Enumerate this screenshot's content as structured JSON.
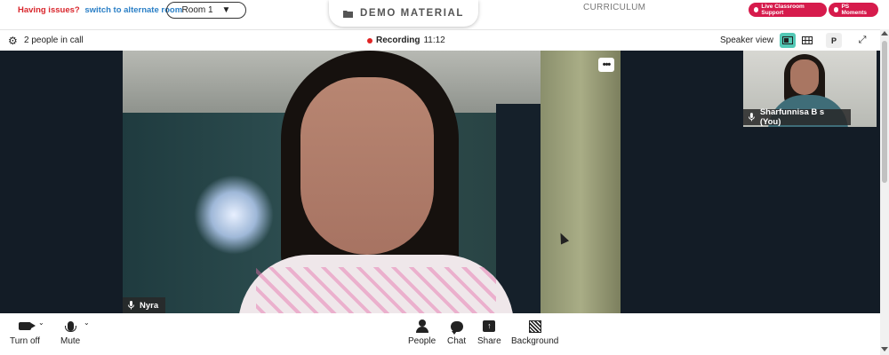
{
  "header": {
    "issue_text": "Having issues?",
    "alternate_link": "switch to alternate room",
    "room_select": {
      "value": "Room 1"
    },
    "demo_tab": "DEMO MATERIAL",
    "curriculum": "CURRICULUM",
    "live_support": "Live Classroom Support",
    "ps_moments": "PS Moments",
    "accent_color": "#d61b4c"
  },
  "call_bar": {
    "people_count": "2 people in call",
    "recording_label": "Recording",
    "recording_time": "11:12",
    "view_label": "Speaker view",
    "pin_label": "P",
    "active_view_color": "#53c8b5"
  },
  "stage": {
    "main_participant": "Nyra",
    "self_participant": "Sharfunnisa B s (You)",
    "more_label": "•••"
  },
  "toolbar": {
    "camera_label": "Turn off",
    "mute_label": "Mute",
    "people_label": "People",
    "chat_label": "Chat",
    "share_label": "Share",
    "background_label": "Background"
  },
  "icons": {
    "settings": "gear-icon",
    "speaker_view": "speaker-view-icon",
    "grid_view": "grid-view-icon",
    "expand": "expand-icon",
    "mic": "microphone-icon",
    "camera": "camera-icon",
    "people": "people-icon",
    "chat": "chat-icon",
    "share": "share-icon",
    "background": "background-icon",
    "folder": "folder-icon"
  }
}
